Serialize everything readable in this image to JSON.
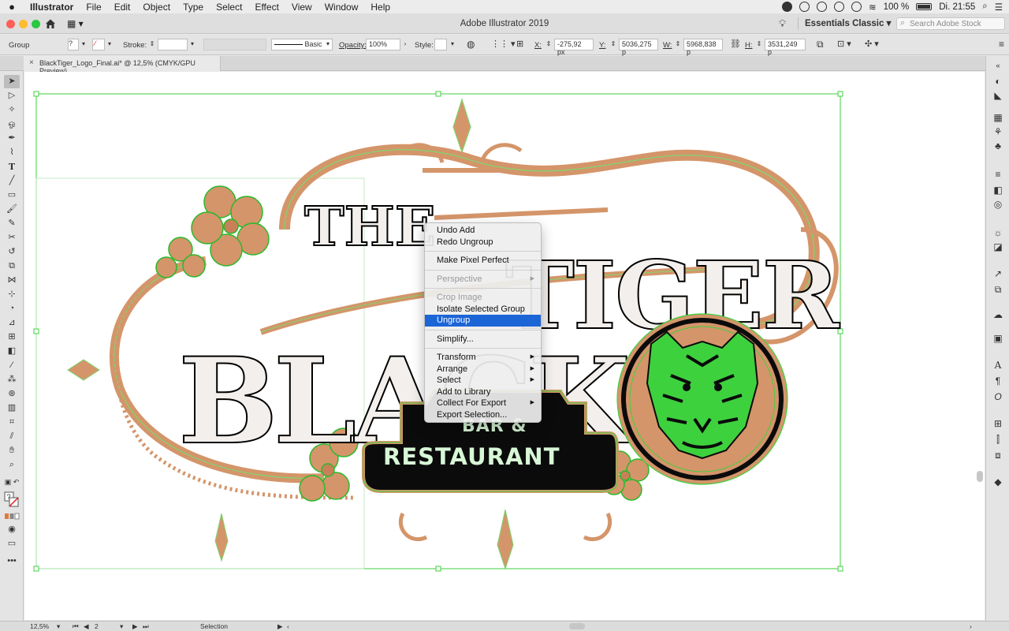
{
  "menubar": {
    "app": "Illustrator",
    "items": [
      "File",
      "Edit",
      "Object",
      "Type",
      "Select",
      "Effect",
      "View",
      "Window",
      "Help"
    ],
    "battery": "100 %",
    "clock": "Di. 21:55"
  },
  "titlebar": {
    "title": "Adobe Illustrator 2019",
    "workspace": "Essentials Classic",
    "search_placeholder": "Search Adobe Stock"
  },
  "controlbar": {
    "selection_type": "Group",
    "stroke_label": "Stroke:",
    "brush": "Basic",
    "opacity_label": "Opacity:",
    "opacity_value": "100%",
    "style_label": "Style:",
    "x_label": "X:",
    "x_value": "-275,92 px",
    "y_label": "Y:",
    "y_value": "5036,275 p",
    "w_label": "W:",
    "w_value": "5968,838 p",
    "h_label": "H:",
    "h_value": "3531,249 p"
  },
  "document": {
    "tab_label": "BlackTiger_Logo_Final.ai* @ 12,5% (CMYK/GPU Preview)"
  },
  "artwork": {
    "word_the": "THE",
    "word_black": "BLACK",
    "word_tiger": "TIGER",
    "line_bar": "BAR &",
    "line_restaurant": "RESTAURANT"
  },
  "context_menu": {
    "undo": "Undo Add",
    "redo": "Redo Ungroup",
    "pixel_perfect": "Make Pixel Perfect",
    "perspective": "Perspective",
    "crop_image": "Crop Image",
    "isolate": "Isolate Selected Group",
    "ungroup": "Ungroup",
    "simplify": "Simplify...",
    "transform": "Transform",
    "arrange": "Arrange",
    "select": "Select",
    "add_library": "Add to Library",
    "collect_export": "Collect For Export",
    "export_selection": "Export Selection..."
  },
  "statusbar": {
    "zoom": "12,5%",
    "artboard": "2",
    "tool": "Selection"
  },
  "colors": {
    "selection": "#3ed13e",
    "ornament": "#d4956a",
    "menu_highlight": "#1c65d6"
  }
}
